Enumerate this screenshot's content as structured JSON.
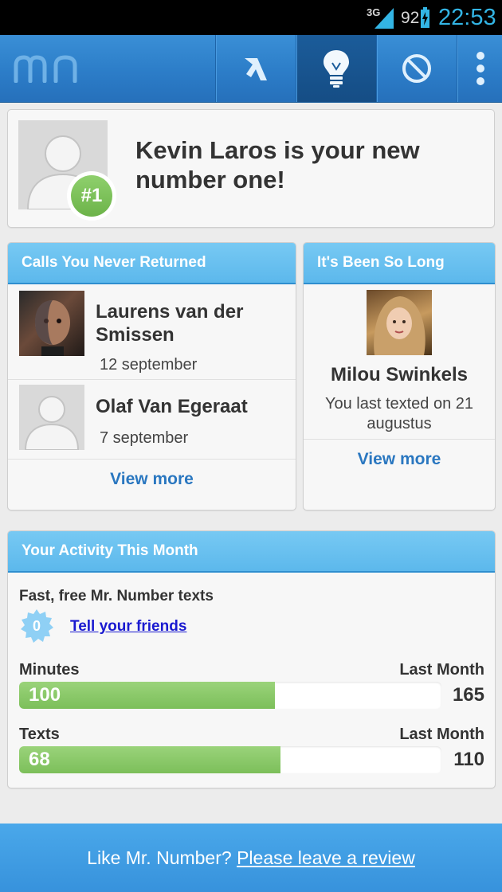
{
  "status_bar": {
    "network": "3G",
    "battery": "92",
    "time": "22:53"
  },
  "action_bar": {
    "logo_icon": "mn-logo",
    "buttons": [
      {
        "icon": "call-filter-icon"
      },
      {
        "icon": "lightbulb-icon"
      },
      {
        "icon": "block-icon"
      },
      {
        "icon": "overflow-menu-icon"
      }
    ]
  },
  "top_card": {
    "badge": "#1",
    "message": "Kevin Laros is your new number one!"
  },
  "calls_card": {
    "title": "Calls You Never Returned",
    "items": [
      {
        "name": "Laurens van der Smissen",
        "date": "12 september"
      },
      {
        "name": "Olaf Van Egeraat",
        "date": "7 september"
      }
    ],
    "view_more": "View more"
  },
  "long_card": {
    "title": "It's Been So Long",
    "name": "Milou Swinkels",
    "subtitle": "You last texted on 21 augustus",
    "view_more": "View more"
  },
  "activity_card": {
    "title": "Your Activity This Month",
    "texts_promo": "Fast, free Mr. Number texts",
    "texts_count": "0",
    "tell_friends": "Tell your friends",
    "minutes": {
      "label": "Minutes",
      "last_label": "Last Month",
      "value": "100",
      "last_value": "165",
      "fraction": 0.606
    },
    "texts": {
      "label": "Texts",
      "last_label": "Last Month",
      "value": "68",
      "last_value": "110",
      "fraction": 0.618
    }
  },
  "footer": {
    "prefix": "Like Mr. Number? ",
    "link": "Please leave a review"
  },
  "colors": {
    "accent": "#2c7dc8",
    "header": "#5cb8ec",
    "bar_green": "#7cbf5a",
    "link": "#2a77c0"
  }
}
